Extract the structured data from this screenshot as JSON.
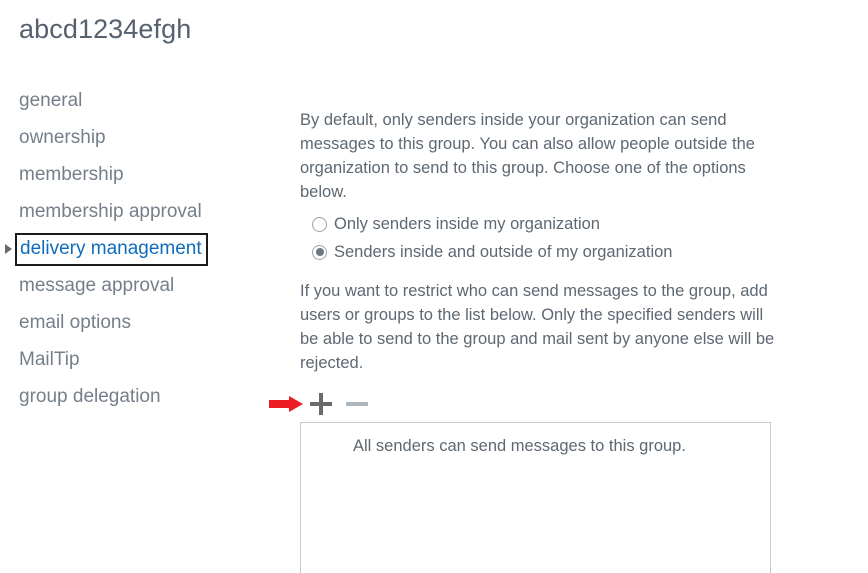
{
  "page": {
    "title": "abcd1234efgh"
  },
  "sidebar": {
    "items": [
      {
        "label": "general",
        "selected": false
      },
      {
        "label": "ownership",
        "selected": false
      },
      {
        "label": "membership",
        "selected": false
      },
      {
        "label": "membership approval",
        "selected": false
      },
      {
        "label": "delivery management",
        "selected": true
      },
      {
        "label": "message approval",
        "selected": false
      },
      {
        "label": "email options",
        "selected": false
      },
      {
        "label": "MailTip",
        "selected": false
      },
      {
        "label": "group delegation",
        "selected": false
      }
    ],
    "caret_icon": "caret-right-icon"
  },
  "main": {
    "intro_paragraph": "By default, only senders inside your organization can send messages to this group. You can also allow people outside the organization to send to this group. Choose one of the options below.",
    "restrict_paragraph": "If you want to restrict who can send messages to the group, add users or groups to the list below. Only the specified senders will be able to send to the group and mail sent by anyone else will be rejected.",
    "radio_options": [
      {
        "label": "Only senders inside my organization",
        "checked": false
      },
      {
        "label": "Senders inside and outside of my organization",
        "checked": true
      }
    ],
    "toolbar": {
      "add_icon": "plus-icon",
      "add_label": "+",
      "remove_icon": "minus-icon",
      "remove_label": "−",
      "remove_disabled": true
    },
    "annotation": {
      "arrow_icon": "red-arrow-right-icon",
      "color": "#ee1c25"
    },
    "listbox": {
      "empty_message": "All senders can send messages to this group."
    }
  },
  "colors": {
    "accent_blue": "#0f6cbd",
    "text_gray": "#5d6873",
    "nav_gray": "#757f8a",
    "border": "#c2cdd6",
    "annotation_red": "#ee1c25"
  }
}
